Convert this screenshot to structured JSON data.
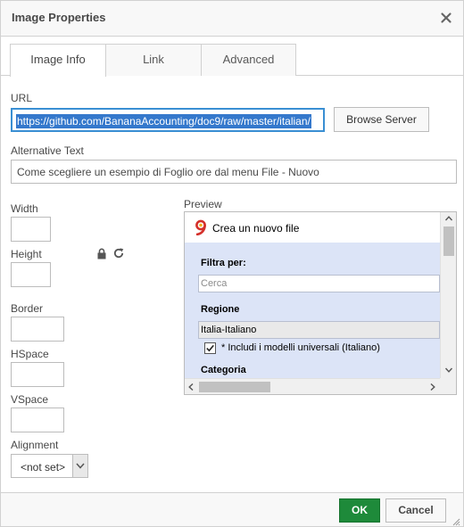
{
  "dialog": {
    "title": "Image Properties"
  },
  "tabs": [
    {
      "label": "Image Info",
      "active": true
    },
    {
      "label": "Link",
      "active": false
    },
    {
      "label": "Advanced",
      "active": false
    }
  ],
  "url": {
    "label": "URL",
    "value": "https://github.com/BananaAccounting/doc9/raw/master/italian/"
  },
  "browse_server": {
    "label": "Browse Server"
  },
  "alt_text": {
    "label": "Alternative Text",
    "value": "Come scegliere un esempio di Foglio ore dal menu File - Nuovo"
  },
  "dimensions": {
    "width_label": "Width",
    "height_label": "Height",
    "width_value": "",
    "height_value": ""
  },
  "spacing": {
    "border_label": "Border",
    "hspace_label": "HSpace",
    "vspace_label": "VSpace"
  },
  "alignment": {
    "label": "Alignment",
    "value": "<not set>"
  },
  "preview": {
    "label": "Preview",
    "window_title": "Crea un nuovo file",
    "filter_label": "Filtra per:",
    "search_placeholder": "Cerca",
    "region_label": "Regione",
    "region_value": "Italia-Italiano",
    "checkbox_label": "* Includi i modelli universali (Italiano)",
    "category_label": "Categoria"
  },
  "footer": {
    "ok_label": "OK",
    "cancel_label": "Cancel"
  },
  "colors": {
    "ok_button": "#1e8a3a",
    "selection": "#3478cc",
    "url_border": "#3a8fd3",
    "preview_bg": "#dce4f7"
  }
}
